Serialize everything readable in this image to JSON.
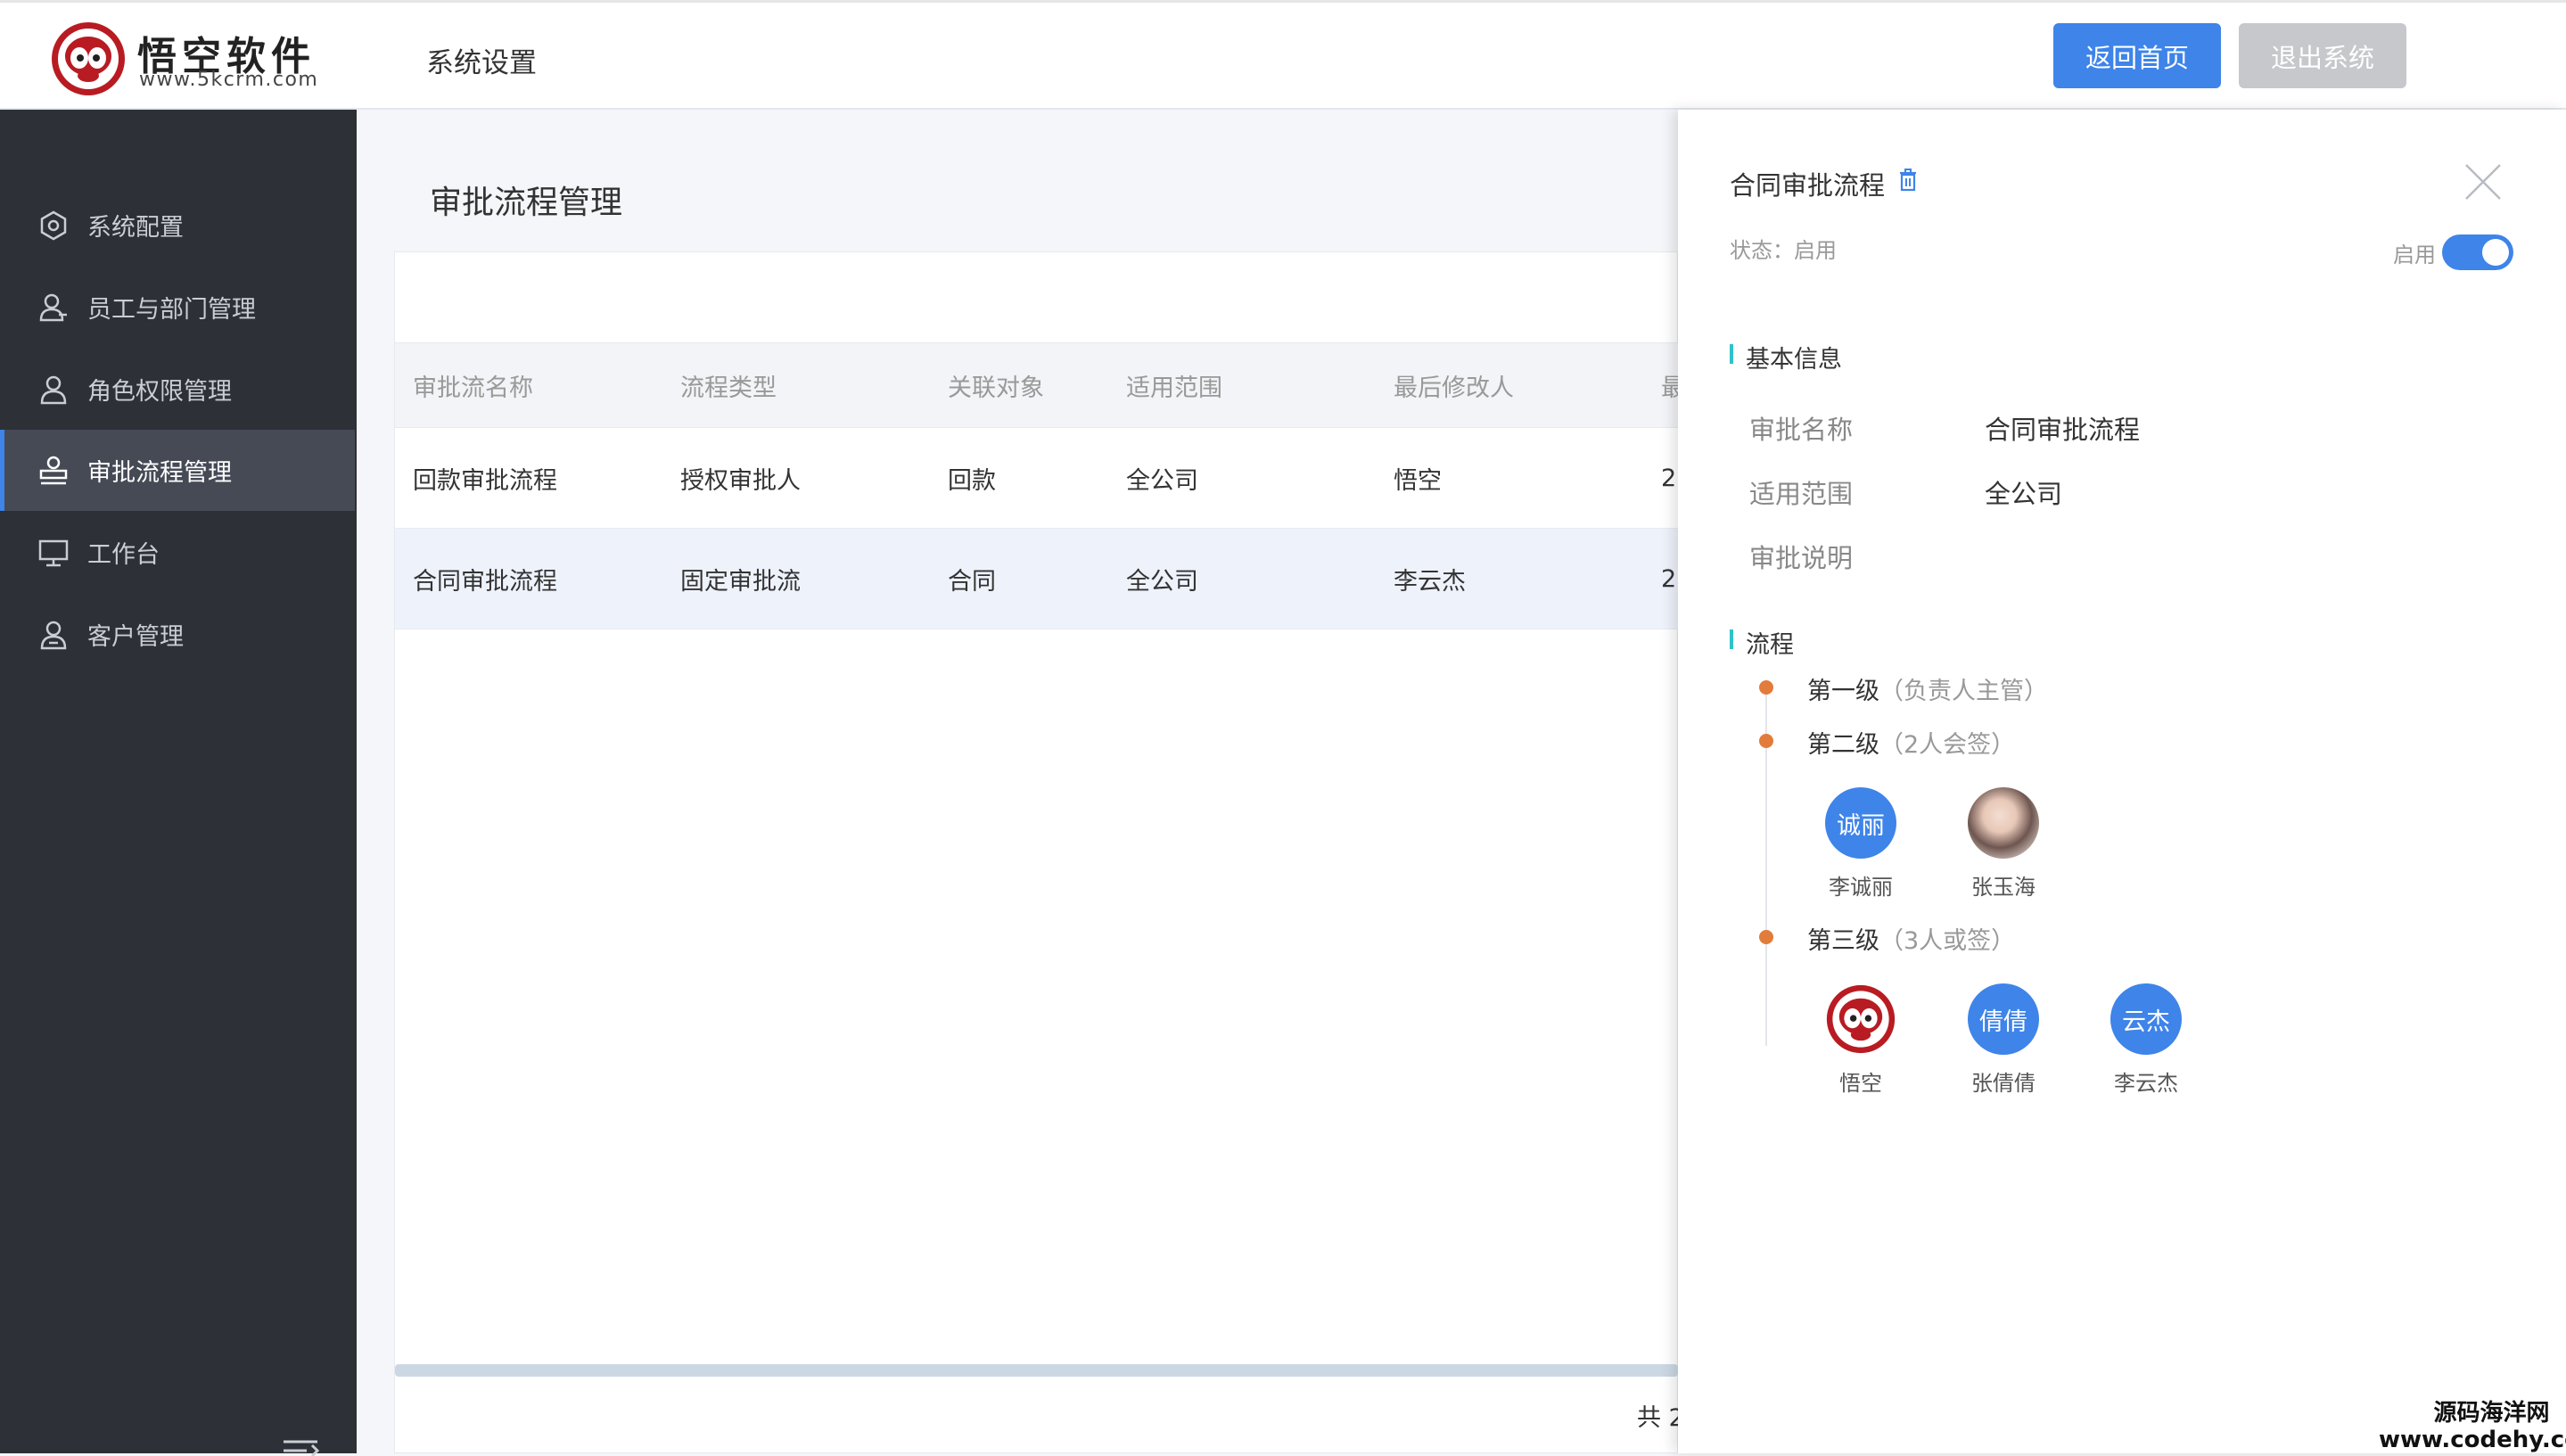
{
  "header": {
    "logo_text": "悟空软件",
    "logo_url": "www.5kcrm.com",
    "section_title": "系统设置",
    "home_button": "返回首页",
    "exit_button": "退出系统",
    "accent": "#3e84e9"
  },
  "sidebar": {
    "items": [
      {
        "label": "系统配置",
        "icon": "hexagon-settings-icon"
      },
      {
        "label": "员工与部门管理",
        "icon": "users-icon"
      },
      {
        "label": "角色权限管理",
        "icon": "user-icon"
      },
      {
        "label": "审批流程管理",
        "icon": "stamp-icon",
        "active": true
      },
      {
        "label": "工作台",
        "icon": "monitor-icon"
      },
      {
        "label": "客户管理",
        "icon": "customer-icon"
      }
    ]
  },
  "main": {
    "title": "审批流程管理",
    "columns": [
      "审批流名称",
      "流程类型",
      "关联对象",
      "适用范围",
      "最后修改人",
      "最"
    ],
    "rows": [
      [
        "回款审批流程",
        "授权审批人",
        "回款",
        "全公司",
        "悟空",
        "2"
      ],
      [
        "合同审批流程",
        "固定审批流",
        "合同",
        "全公司",
        "李云杰",
        "2"
      ]
    ],
    "footer_total": "共 2"
  },
  "drawer": {
    "title": "合同审批流程",
    "status": "状态：启用",
    "toggle_label": "启用",
    "toggle_on": true,
    "basic_info_heading": "基本信息",
    "fields": [
      {
        "label": "审批名称",
        "value": "合同审批流程"
      },
      {
        "label": "适用范围",
        "value": "全公司"
      },
      {
        "label": "审批说明",
        "value": ""
      }
    ],
    "flow_heading": "流程",
    "levels": [
      {
        "name": "第一级",
        "detail": "（负责人主管）",
        "people": []
      },
      {
        "name": "第二级",
        "detail": "（2人会签）",
        "people": [
          {
            "avatar_text": "诚丽",
            "name": "李诚丽"
          },
          {
            "avatar_text": "",
            "name": "张玉海",
            "photo": true
          }
        ]
      },
      {
        "name": "第三级",
        "detail": "（3人或签）",
        "people": [
          {
            "avatar_text": "",
            "name": "悟空",
            "logo": true
          },
          {
            "avatar_text": "倩倩",
            "name": "张倩倩"
          },
          {
            "avatar_text": "云杰",
            "name": "李云杰"
          }
        ]
      }
    ],
    "dot_color": "#e27c3b"
  },
  "watermark": {
    "line1": "源码海洋网",
    "line2": "www.codehy.com"
  }
}
